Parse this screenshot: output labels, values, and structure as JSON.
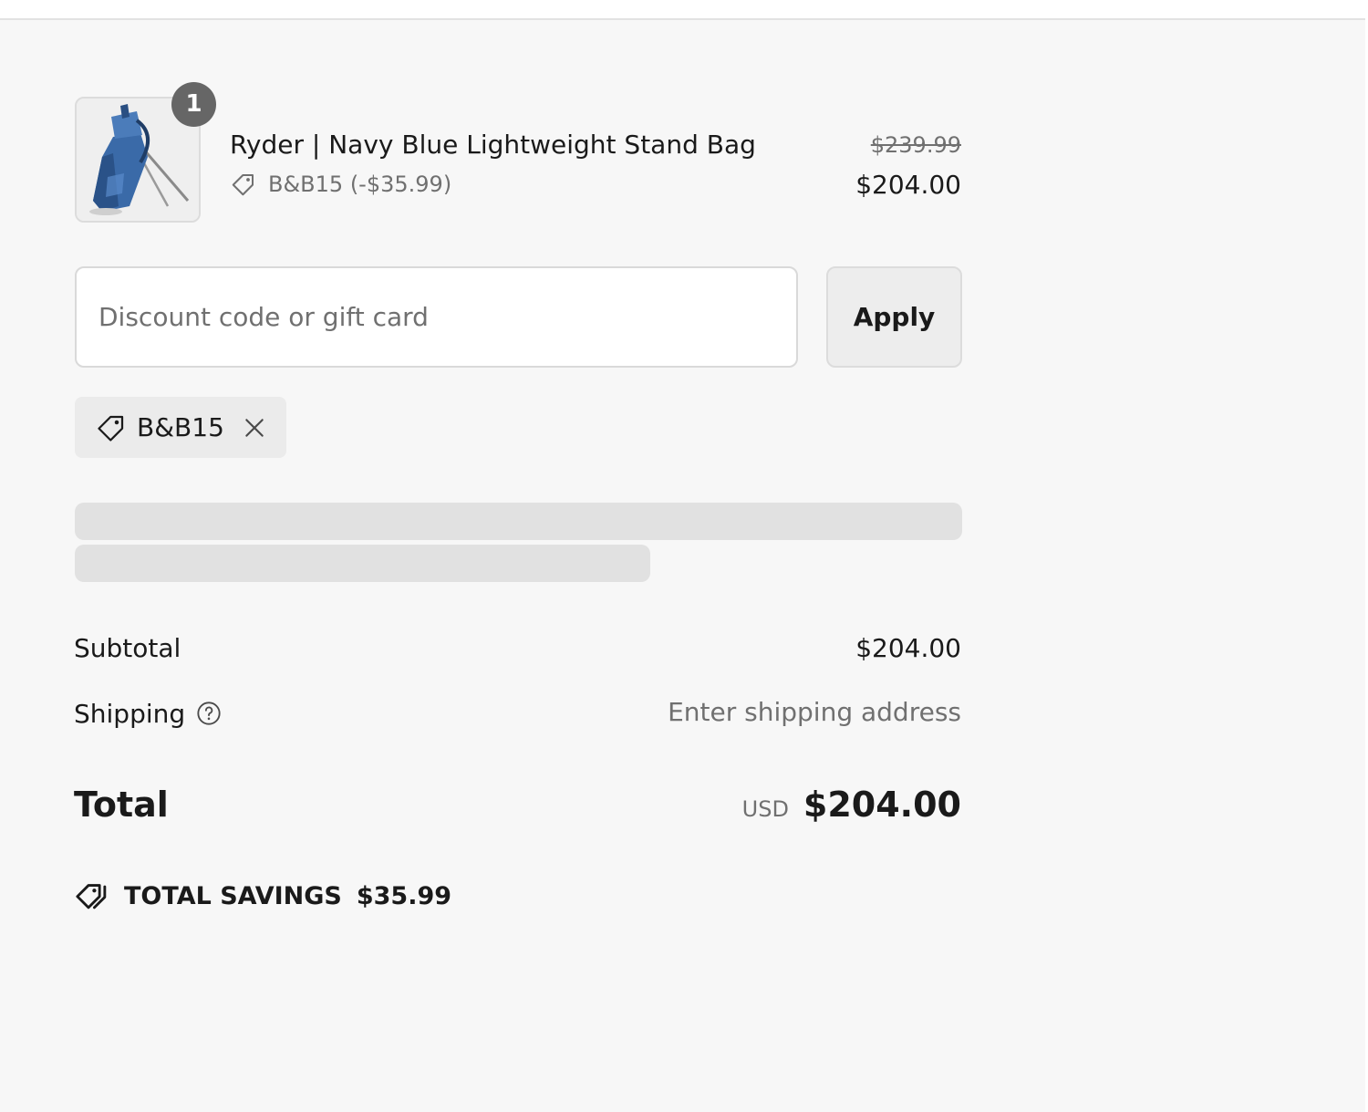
{
  "product": {
    "quantity": "1",
    "title": "Ryder | Navy Blue Lightweight Stand Bag",
    "discount_line": "B&B15 (-$35.99)",
    "original_price": "$239.99",
    "final_price": "$204.00",
    "image_icon": "golf-stand-bag-image",
    "image_color": "#3a6aa8"
  },
  "discount_form": {
    "placeholder": "Discount code or gift card",
    "value": "",
    "apply_label": "Apply"
  },
  "applied_code": {
    "code": "B&B15",
    "icon": "tag-icon",
    "remove_icon": "close-icon"
  },
  "summary": {
    "subtotal_label": "Subtotal",
    "subtotal_value": "$204.00",
    "shipping_label": "Shipping",
    "shipping_value": "Enter shipping address",
    "total_label": "Total",
    "currency": "USD",
    "total_value": "$204.00",
    "savings_label": "TOTAL SAVINGS",
    "savings_value": "$35.99"
  },
  "colors": {
    "background": "#f7f7f7",
    "badge": "#666666",
    "muted_text": "#707070",
    "skeleton": "#e1e1e1"
  }
}
